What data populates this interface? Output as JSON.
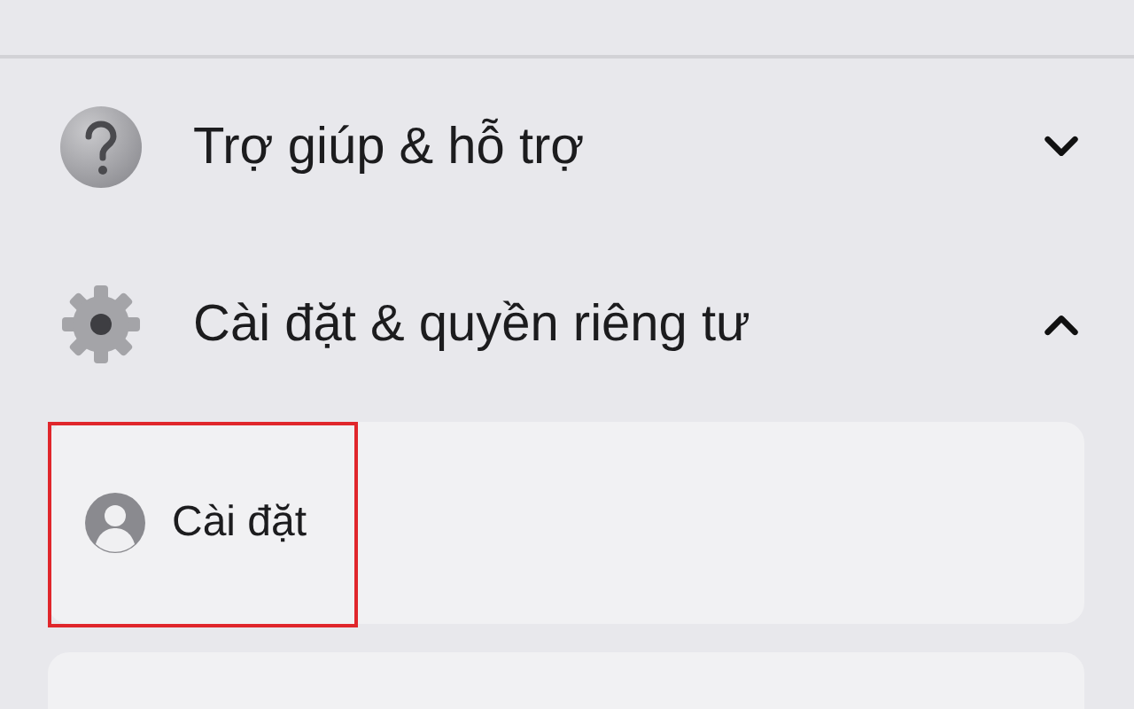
{
  "sections": [
    {
      "kind": "help",
      "label": "Trợ giúp & hỗ trợ",
      "expanded": false
    },
    {
      "kind": "settings",
      "label": "Cài đặt & quyền riêng tư",
      "expanded": true,
      "items": [
        {
          "label": "Cài đặt",
          "highlighted": true
        }
      ]
    }
  ]
}
